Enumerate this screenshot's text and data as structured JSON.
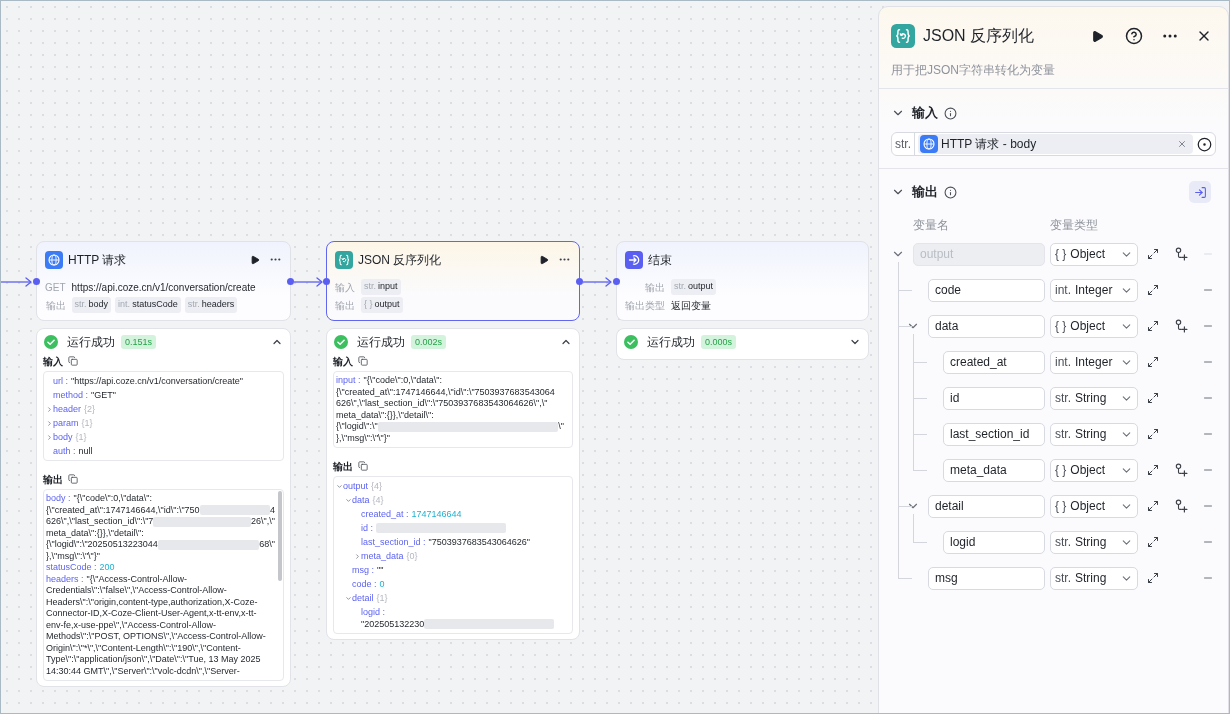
{
  "canvas": {
    "nodes": [
      {
        "kind": "http",
        "title": "HTTP 请求",
        "selected": false,
        "rows": [
          {
            "kind": "text",
            "label": "GET",
            "text": "https://api.coze.cn/v1/conversation/create"
          },
          {
            "kind": "tags",
            "label": "输出",
            "tags": [
              {
                "type": "str.",
                "name": "body"
              },
              {
                "type": "int.",
                "name": "statusCode"
              },
              {
                "type": "str.",
                "name": "headers"
              }
            ]
          }
        ],
        "result": {
          "status": "运行成功",
          "time": "0.151s",
          "expanded": true,
          "sections": [
            {
              "title": "输入",
              "scrollbar": false,
              "entries": [
                {
                  "label": "url :",
                  "kind": "string",
                  "lines": [
                    "\"https://api.coze.cn/v1/conversation/create\""
                  ]
                },
                {
                  "label": "method :",
                  "kind": "string",
                  "lines": [
                    "\"GET\""
                  ]
                },
                {
                  "label": "header",
                  "count": "{2}",
                  "expanded": false
                },
                {
                  "label": "param",
                  "count": "{1}",
                  "expanded": false
                },
                {
                  "label": "body",
                  "count": "{1}",
                  "expanded": false
                },
                {
                  "label": "auth :",
                  "kind": "null",
                  "lines": [
                    "null"
                  ]
                }
              ]
            },
            {
              "title": "输出",
              "scrollbar": true,
              "entries": [
                {
                  "label": "body :",
                  "kind": "string",
                  "lines": [
                    "\"{\\\"code\\\":0,\\\"data\\\":",
                    [
                      "{\\\"created_at\\\":1747146644,\\\"id\\\":\\\"750",
                      {
                        "kind": "blur"
                      },
                      "4"
                    ],
                    [
                      "626\\\",\\\"last_section_id\\\":\\\"7",
                      {
                        "kind": "blur"
                      },
                      "26\\\",\\\""
                    ],
                    "meta_data\\\":{}},\\\"detail\\\":",
                    [
                      "{\\\"logid\\\":\\\"20250513223044",
                      {
                        "kind": "blur"
                      },
                      "68\\\""
                    ],
                    "},\\\"msg\\\":\\\"\\\"}\""
                  ]
                },
                {
                  "label": "statusCode :",
                  "kind": "number",
                  "lines": [
                    "200"
                  ]
                },
                {
                  "label": "headers :",
                  "kind": "string",
                  "lines": [
                    "\"{\\\"Access-Control-Allow-",
                    "Credentials\\\":\\\"false\\\",\\\"Access-Control-Allow-",
                    "Headers\\\":\\\"origin,content-type,authorization,X-Coze-",
                    "Connector-ID,X-Coze-Client-User-Agent,x-tt-env,x-tt-",
                    "env-fe,x-use-ppe\\\",\\\"Access-Control-Allow-",
                    "Methods\\\":\\\"POST, OPTIONS\\\",\\\"Access-Control-Allow-",
                    "Origin\\\":\\\"*\\\",\\\"Content-Length\\\":\\\"190\\\",\\\"Content-",
                    "Type\\\":\\\"application/json\\\",\\\"Date\\\":\\\"Tue, 13 May 2025",
                    "14:30:44 GMT\\\",\\\"Server\\\":\\\"volc-dcdn\\\",\\\"Server-"
                  ]
                }
              ]
            }
          ]
        }
      },
      {
        "kind": "json",
        "title": "JSON 反序列化",
        "selected": true,
        "rows": [
          {
            "kind": "tags",
            "label": "输入",
            "tags": [
              {
                "type": "str.",
                "name": "input"
              }
            ]
          },
          {
            "kind": "tags",
            "label": "输出",
            "tags": [
              {
                "type": "{ }",
                "name": "output"
              }
            ]
          }
        ],
        "result": {
          "status": "运行成功",
          "time": "0.002s",
          "expanded": true,
          "sections": [
            {
              "title": "输入",
              "scrollbar": false,
              "entries": [
                {
                  "label": "input :",
                  "kind": "string",
                  "lines": [
                    "\"{\\\"code\\\":0,\\\"data\\\":",
                    "{\\\"created_at\\\":1747146644,\\\"id\\\":\\\"7503937683543064",
                    "626\\\",\\\"last_section_id\\\":\\\"7503937683543064626\\\",\\\"",
                    "meta_data\\\":{}},\\\"detail\\\":",
                    [
                      "{\\\"logid\\\":\\\"",
                      {
                        "kind": "blur"
                      },
                      "\\\""
                    ],
                    "},\\\"msg\\\":\\\"\\\"}\""
                  ]
                }
              ]
            },
            {
              "title": "输出",
              "scrollbar": false,
              "entries": [
                {
                  "label": "output",
                  "count": "{4}",
                  "expanded": true,
                  "children": [
                    {
                      "label": "data",
                      "count": "{4}",
                      "expanded": true,
                      "children": [
                        {
                          "label": "created_at :",
                          "kind": "number",
                          "lines": [
                            "1747146644"
                          ]
                        },
                        {
                          "label": "id :",
                          "kind": "string",
                          "lines": [
                            [
                              {
                                "kind": "blur"
                              }
                            ]
                          ]
                        },
                        {
                          "label": "last_section_id :",
                          "kind": "string",
                          "lines": [
                            "\"7503937683543064626\""
                          ]
                        },
                        {
                          "label": "meta_data",
                          "count": "{0}",
                          "expanded": false
                        }
                      ]
                    },
                    {
                      "label": "msg :",
                      "kind": "string",
                      "lines": [
                        "\"\""
                      ]
                    },
                    {
                      "label": "code :",
                      "kind": "number",
                      "lines": [
                        "0"
                      ]
                    },
                    {
                      "label": "detail",
                      "count": "{1}",
                      "expanded": true,
                      "children": [
                        {
                          "label": "logid :",
                          "kind": "string",
                          "lines": [
                            [
                              "\"202505132230",
                              {
                                "kind": "blur"
                              }
                            ]
                          ]
                        }
                      ]
                    }
                  ]
                }
              ]
            }
          ]
        }
      },
      {
        "kind": "end",
        "title": "结束",
        "selected": false,
        "rows": [
          {
            "kind": "tags",
            "label": "输出",
            "tags": [
              {
                "type": "str.",
                "name": "output"
              }
            ]
          },
          {
            "kind": "text",
            "label": "输出类型",
            "text": "返回变量"
          }
        ],
        "result": {
          "status": "运行成功",
          "time": "0.000s",
          "expanded": false
        }
      }
    ]
  },
  "panel": {
    "kind": "json",
    "title": "JSON 反序列化",
    "description": "用于把JSON字符串转化为变量",
    "input": {
      "title": "输入",
      "expanded": true,
      "field": {
        "type": "str.",
        "source": "HTTP 请求 - body"
      }
    },
    "output": {
      "title": "输出",
      "expanded": true,
      "columns": [
        "变量名",
        "变量类型"
      ],
      "variables": [
        {
          "name": "output",
          "disabled": true,
          "kind": "object",
          "type_icon": "{ }",
          "type": "Object",
          "expanded": true,
          "children": [
            {
              "name": "code",
              "disabled": false,
              "kind": "integer",
              "type_icon": "int.",
              "type": "Integer"
            },
            {
              "name": "data",
              "disabled": false,
              "kind": "object",
              "type_icon": "{ }",
              "type": "Object",
              "expanded": true,
              "children": [
                {
                  "name": "created_at",
                  "disabled": false,
                  "kind": "integer",
                  "type_icon": "int.",
                  "type": "Integer"
                },
                {
                  "name": "id",
                  "disabled": false,
                  "kind": "string",
                  "type_icon": "str.",
                  "type": "String"
                },
                {
                  "name": "last_section_id",
                  "disabled": false,
                  "kind": "string",
                  "type_icon": "str.",
                  "type": "String"
                },
                {
                  "name": "meta_data",
                  "disabled": false,
                  "kind": "object",
                  "type_icon": "{ }",
                  "type": "Object"
                }
              ]
            },
            {
              "name": "detail",
              "disabled": false,
              "kind": "object",
              "type_icon": "{ }",
              "type": "Object",
              "expanded": true,
              "children": [
                {
                  "name": "logid",
                  "disabled": false,
                  "kind": "string",
                  "type_icon": "str.",
                  "type": "String"
                }
              ]
            },
            {
              "name": "msg",
              "disabled": false,
              "kind": "string",
              "type_icon": "str.",
              "type": "String"
            }
          ]
        }
      ]
    }
  }
}
